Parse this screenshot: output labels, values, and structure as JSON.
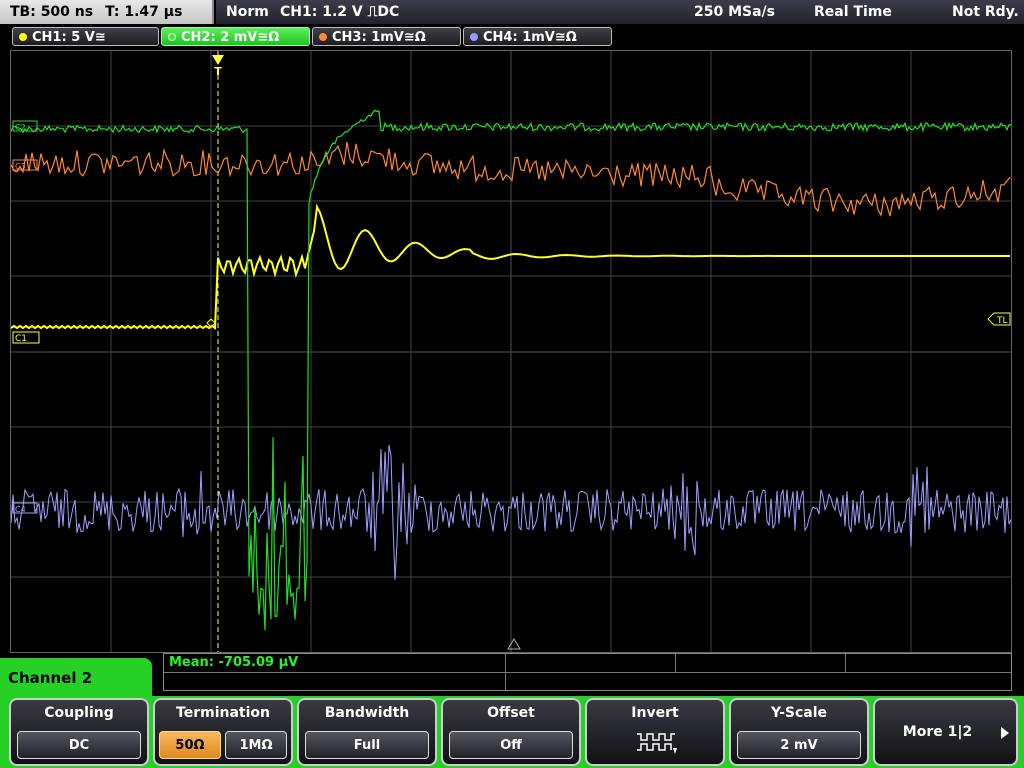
{
  "header": {
    "timebase": "TB: 500 ns",
    "trigger_time": "T: 1.47 µs",
    "mode": "Norm",
    "trigger": "CH1: 1.2 V ⎍DC",
    "sample_rate": "250 MSa/s",
    "acq_mode": "Real Time",
    "status": "Not Rdy."
  },
  "channel_tabs": [
    {
      "label": "CH1: 5 V≅",
      "color": "#ffff00",
      "active": false
    },
    {
      "label": "CH2: 2 mV≅Ω",
      "color": "#33ee33",
      "active": true
    },
    {
      "label": "CH3: 1mV≅Ω",
      "color": "#ff8833",
      "active": false
    },
    {
      "label": "CH4: 1mV≅Ω",
      "color": "#9999ff",
      "active": false
    }
  ],
  "screen": {
    "ref_labels": {
      "ch1": "C1",
      "ch2": "C2",
      "ch3": "C3",
      "ch4": "C4",
      "trigger_level": "TL",
      "trigger_marker": "T"
    },
    "colors": {
      "ch1": "#ffff22",
      "ch2": "#22dd22",
      "ch3": "#ff8833",
      "ch4": "#9f9fff",
      "grid": "#444444"
    }
  },
  "measurement": {
    "text": "Mean: -705.09 µV"
  },
  "menu": {
    "channel_label": "Channel 2",
    "coupling": {
      "title": "Coupling",
      "value": "DC"
    },
    "termination": {
      "title": "Termination",
      "opt1": "50Ω",
      "opt2": "1MΩ"
    },
    "bandwidth": {
      "title": "Bandwidth",
      "value": "Full"
    },
    "offset": {
      "title": "Offset",
      "value": "Off"
    },
    "invert": {
      "title": "Invert",
      "icon": "invert-waveform-icon"
    },
    "yscale": {
      "title": "Y-Scale",
      "value": "2 mV"
    },
    "more": {
      "label": "More 1|2",
      "icon": "arrow-right-icon"
    }
  }
}
